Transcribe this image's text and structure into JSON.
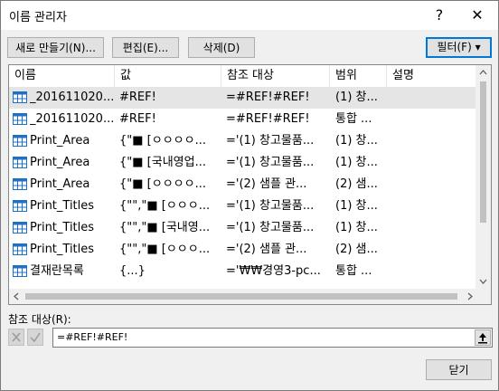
{
  "window": {
    "title": "이름 관리자",
    "help_label": "?",
    "close_label": "✕"
  },
  "toolbar": {
    "new_label": "새로 만들기(N)...",
    "edit_label": "편집(E)...",
    "delete_label": "삭제(D)",
    "filter_label": "필터(F) ▾"
  },
  "table": {
    "columns": [
      "이름",
      "값",
      "참조 대상",
      "범위",
      "설명"
    ],
    "rows": [
      {
        "name": "_201611020...",
        "value": "#REF!",
        "ref": "=#REF!#REF!",
        "scope": "(1) 창...",
        "desc": ""
      },
      {
        "name": "_201611020...",
        "value": "#REF!",
        "ref": "=#REF!#REF!",
        "scope": "통합 ...",
        "desc": ""
      },
      {
        "name": "Print_Area",
        "value": "{\"■ [ㅇㅇㅇㅇ...",
        "ref": "='(1) 창고물품...",
        "scope": "(1) 창...",
        "desc": ""
      },
      {
        "name": "Print_Area",
        "value": "{\"■ [국내영업...",
        "ref": "='(1) 창고물품...",
        "scope": "(1) 창...",
        "desc": ""
      },
      {
        "name": "Print_Area",
        "value": "{\"■ [ㅇㅇㅇㅇ...",
        "ref": "='(2) 샘플 관...",
        "scope": "(2) 샘...",
        "desc": ""
      },
      {
        "name": "Print_Titles",
        "value": "{\"\",\"■ [ㅇㅇㅇ...",
        "ref": "='(1) 창고물품...",
        "scope": "(1) 창...",
        "desc": ""
      },
      {
        "name": "Print_Titles",
        "value": "{\"\",\"■ [국내영...",
        "ref": "='(1) 창고물품...",
        "scope": "(1) 창...",
        "desc": ""
      },
      {
        "name": "Print_Titles",
        "value": "{\"\",\"■ [ㅇㅇㅇ...",
        "ref": "='(2) 샘플 관...",
        "scope": "(2) 샘...",
        "desc": ""
      },
      {
        "name": "결재란목록",
        "value": "{...}",
        "ref": "='₩₩경영3-pc...",
        "scope": "통합 ...",
        "desc": ""
      }
    ]
  },
  "reference": {
    "label": "참조 대상(R):",
    "value": "=#REF!#REF!"
  },
  "footer": {
    "close_label": "닫기"
  },
  "colors": {
    "accent": "#0078d7",
    "selected_row": "#e5e5e5",
    "grid_icon": "#1e6fc7"
  }
}
